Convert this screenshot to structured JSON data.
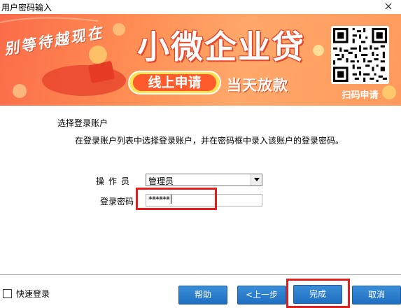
{
  "window": {
    "title": "用户密码输入"
  },
  "banner": {
    "slogan": "别等待越现在",
    "headline": "小微企业贷",
    "apply": "线上申请",
    "sameday": "当天放款",
    "qr_label": "扫码申请"
  },
  "form": {
    "section_title": "选择登录账户",
    "section_desc": "在登录账户列表中选择登录账户，并在密码框中录入该账户的登录密码。",
    "operator_label": "操作员",
    "operator_value": "管理员",
    "password_label": "登录密码",
    "password_value": "******"
  },
  "footer": {
    "quick_login": "快速登录",
    "help": "帮助",
    "prev": "<上一步",
    "finish": "完成",
    "cancel": "取消"
  },
  "colors": {
    "accent": "#1f6fc1",
    "highlight": "#e21d1d",
    "banner": "#ff8f54"
  }
}
